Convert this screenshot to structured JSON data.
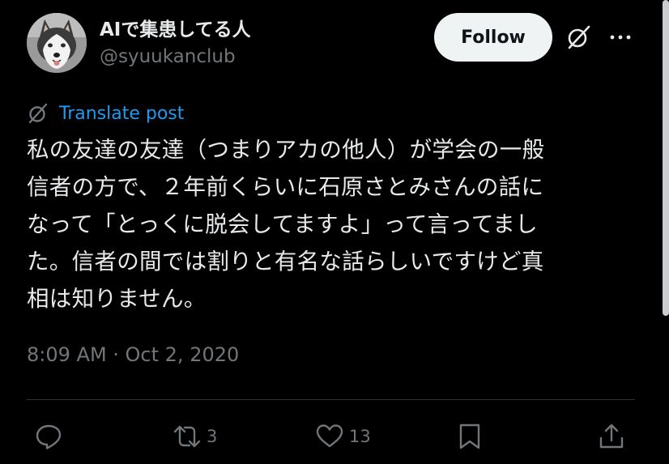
{
  "user": {
    "display_name": "AIで集患してる人",
    "handle": "@syuukanclub",
    "avatar_icon": "husky-avatar"
  },
  "actions": {
    "follow_label": "Follow"
  },
  "translate": {
    "label": "Translate post",
    "icon": "translate-icon"
  },
  "post": {
    "lines": [
      "私の友達の友達（つまりアカの他人）が学会の一般",
      "信者の方で、２年前くらいに石原さとみさんの話に",
      "なって「とっくに脱会してますよ」って言ってまし",
      "た。信者の間では割りと有名な話らしいですけど真",
      "相は知りません。"
    ],
    "timestamp": "8:09 AM · Oct 2, 2020"
  },
  "engagement": {
    "retweets": "3",
    "likes": "13"
  },
  "colors": {
    "background": "#000000",
    "text": "#e7e9ea",
    "secondary": "#71767b",
    "link": "#1d9bf0",
    "follow_bg": "#eff3f4"
  }
}
